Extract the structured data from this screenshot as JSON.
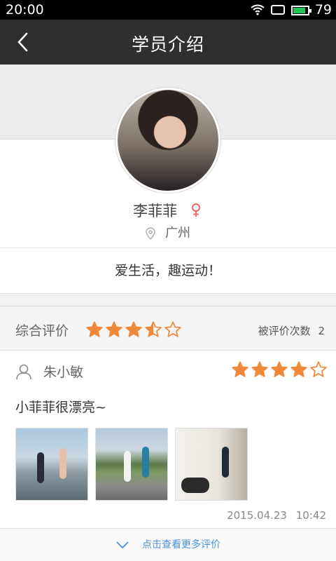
{
  "status": {
    "time": "20:00",
    "battery": "79"
  },
  "nav": {
    "title": "学员介绍",
    "back_icon": "back-chevron-icon"
  },
  "profile": {
    "name": "李菲菲",
    "gender_icon": "female-icon",
    "location": "广州",
    "motto": "爱生活，趣运动！"
  },
  "rating": {
    "label": "综合评价",
    "stars": 3.5,
    "count_label": "被评价次数",
    "count": "2"
  },
  "review": {
    "reviewer": "朱小敏",
    "stars": 4,
    "text": "小菲菲很漂亮~",
    "date": "2015.04.23",
    "time": "10:42",
    "photos": [
      "running-photo-1",
      "running-photo-2",
      "running-photo-3"
    ]
  },
  "more": {
    "label": "点击查看更多评价"
  },
  "colors": {
    "accent_orange": "#f0883b",
    "link_blue": "#4a90d9",
    "nav_bg": "#2f2f2f",
    "gender_pink": "#f0706b"
  }
}
